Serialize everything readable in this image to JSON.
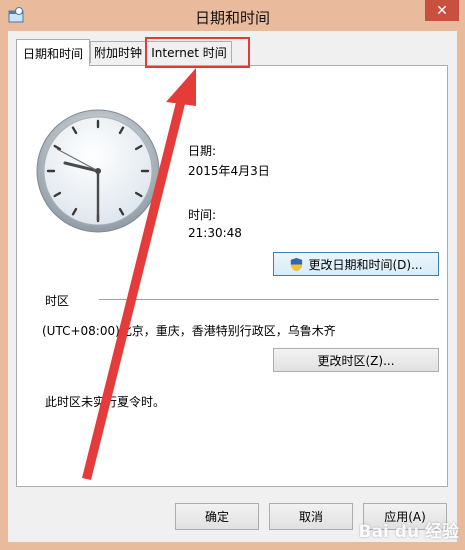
{
  "window": {
    "title": "日期和时间",
    "close_glyph": "✕"
  },
  "tabs": [
    {
      "label": "日期和时间",
      "active": true
    },
    {
      "label": "附加时钟",
      "active": false
    },
    {
      "label": "Internet 时间",
      "active": false
    }
  ],
  "datetime": {
    "date_label": "日期:",
    "date_value": "2015年4月3日",
    "time_label": "时间:",
    "time_value": "21:30:48",
    "change_button": "更改日期和时间(D)..."
  },
  "timezone": {
    "section_label": "时区",
    "value": "(UTC+08:00)北京，重庆，香港特别行政区，乌鲁木齐",
    "change_button": "更改时区(Z)...",
    "dst_note": "此时区未实行夏令时。"
  },
  "footer": {
    "ok": "确定",
    "cancel": "取消",
    "apply": "应用(A)"
  },
  "watermark": "Bai du 经验",
  "colors": {
    "accent_red": "#e23a36",
    "close_red": "#c7503f"
  }
}
